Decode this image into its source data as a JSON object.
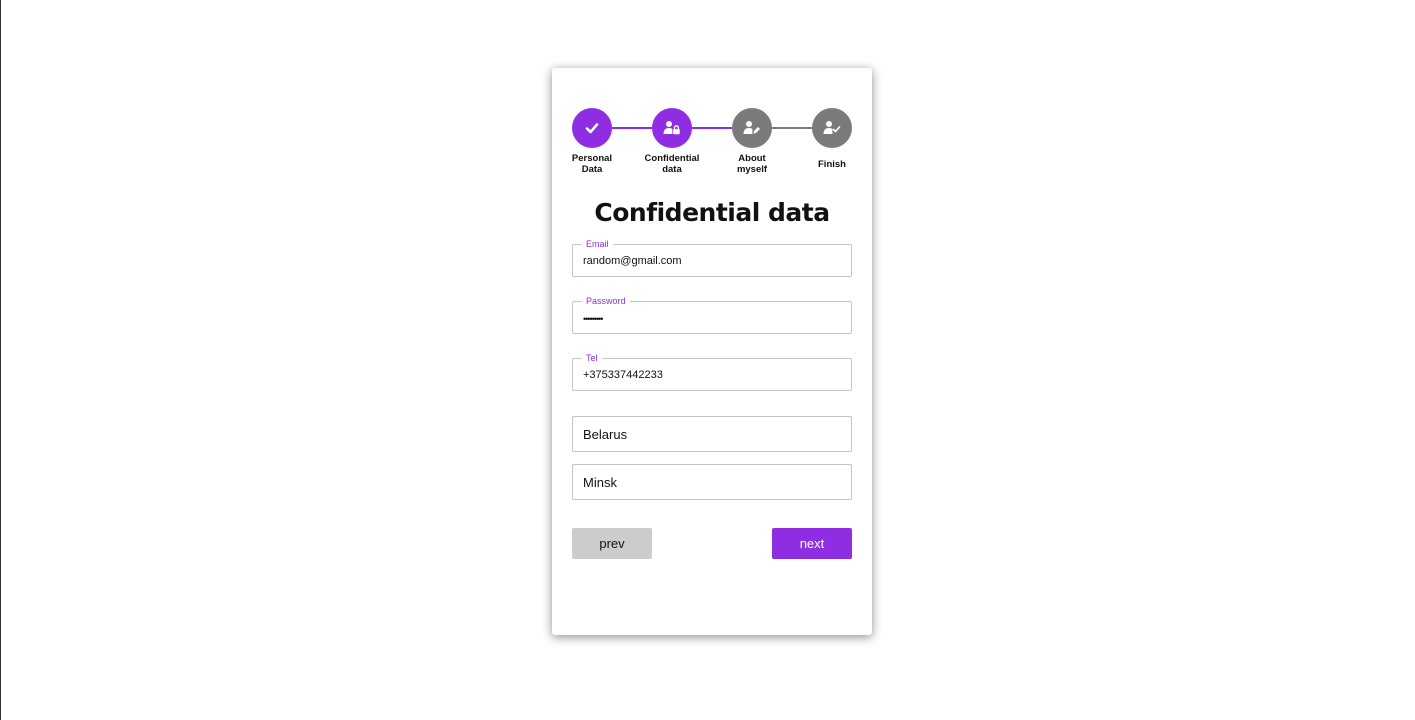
{
  "colors": {
    "accent": "#8e2de2",
    "inactive_step": "#7a7a7a",
    "prev_button_bg": "#cccccc"
  },
  "stepper": {
    "steps": [
      {
        "label": "Personal Data",
        "icon": "check-icon",
        "state": "completed"
      },
      {
        "label": "Confidential data",
        "icon": "user-lock-icon",
        "state": "active"
      },
      {
        "label": "About myself",
        "icon": "user-edit-icon",
        "state": "inactive"
      },
      {
        "label": "Finish",
        "icon": "user-check-icon",
        "state": "inactive"
      }
    ]
  },
  "form": {
    "title": "Confidential data",
    "email": {
      "label": "Email",
      "value": "random@gmail.com"
    },
    "password": {
      "label": "Password",
      "value": "•••••••••"
    },
    "tel": {
      "label": "Tel",
      "value": "+375337442233"
    },
    "country": {
      "value": "Belarus"
    },
    "city": {
      "value": "Minsk"
    }
  },
  "buttons": {
    "prev_label": "prev",
    "next_label": "next"
  }
}
